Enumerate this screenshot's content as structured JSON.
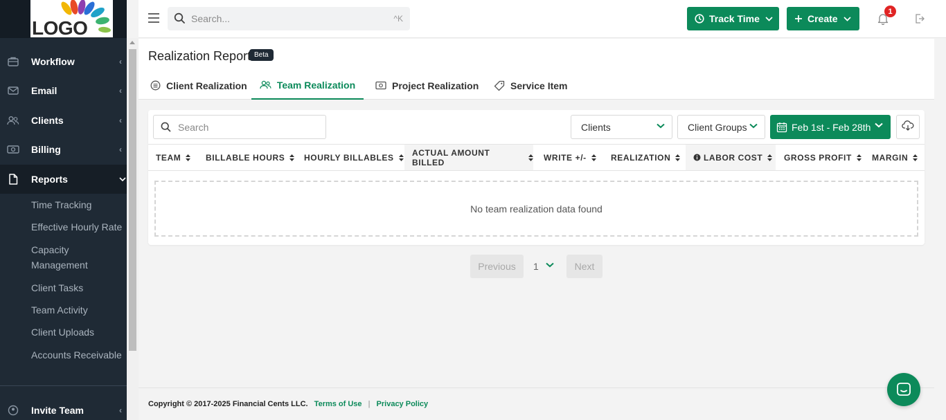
{
  "sidebar": {
    "logo_text": "LOGO",
    "nav": [
      {
        "label": "Workflow",
        "icon": "briefcase-icon"
      },
      {
        "label": "Email",
        "icon": "envelope-icon"
      },
      {
        "label": "Clients",
        "icon": "users-icon"
      },
      {
        "label": "Billing",
        "icon": "money-icon"
      },
      {
        "label": "Reports",
        "icon": "file-icon"
      }
    ],
    "reports_sub": [
      "Time Tracking",
      "Effective Hourly Rate",
      "Capacity Management",
      "Client Tasks",
      "Team Activity",
      "Client Uploads",
      "Accounts Receivable"
    ],
    "invite": {
      "label": "Invite Team",
      "icon": "user-plus-icon"
    }
  },
  "topbar": {
    "search_placeholder": "Search...",
    "search_shortcut": "^K",
    "track_time_label": "Track Time",
    "create_label": "Create",
    "notification_count": "1"
  },
  "page": {
    "title": "Realization Report",
    "badge": "Beta",
    "tabs": [
      {
        "label": "Client Realization",
        "icon": "list-icon",
        "active": false
      },
      {
        "label": "Team Realization",
        "icon": "team-icon",
        "active": true
      },
      {
        "label": "Project Realization",
        "icon": "cash-icon",
        "active": false
      },
      {
        "label": "Service Item",
        "icon": "tag-icon",
        "active": false
      }
    ]
  },
  "filters": {
    "search_placeholder": "Search",
    "clients_label": "Clients",
    "client_groups_label": "Client Groups",
    "date_range": "Feb 1st - Feb 28th"
  },
  "table": {
    "columns": [
      "TEAM",
      "BILLABLE HOURS",
      "HOURLY BILLABLES",
      "ACTUAL AMOUNT BILLED",
      "WRITE +/-",
      "REALIZATION",
      "LABOR COST",
      "GROSS PROFIT",
      "MARGIN"
    ],
    "empty_message": "No team realization data found"
  },
  "pagination": {
    "previous": "Previous",
    "page": "1",
    "next": "Next"
  },
  "footer": {
    "copyright": "Copyright © 2017-2025 Financial Cents LLC.",
    "terms": "Terms of Use",
    "separator": "|",
    "privacy": "Privacy Policy"
  },
  "colors": {
    "accent": "#0c8a5a",
    "sidebar": "#1f2a35",
    "badge": "#e02424"
  }
}
